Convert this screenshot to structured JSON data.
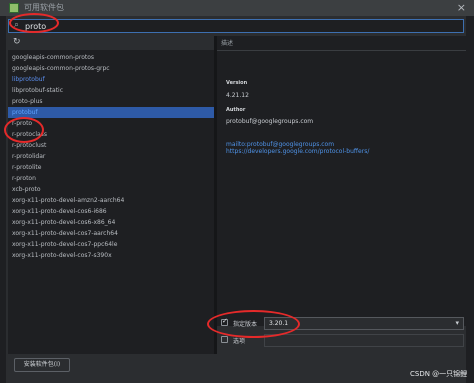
{
  "window": {
    "title": "可用软件包",
    "close_glyph": "×"
  },
  "search": {
    "icon": "search-icon",
    "value": "proto",
    "placeholder": ""
  },
  "toolbar": {
    "refresh_icon": "refresh-icon"
  },
  "packages": {
    "items": [
      {
        "label": "googleapis-common-protos",
        "state": "normal"
      },
      {
        "label": "googleapis-common-protos-grpc",
        "state": "normal"
      },
      {
        "label": "libprotobuf",
        "state": "highlight"
      },
      {
        "label": "libprotobuf-static",
        "state": "normal"
      },
      {
        "label": "proto-plus",
        "state": "normal"
      },
      {
        "label": "protobuf",
        "state": "selected"
      },
      {
        "label": "r-proto",
        "state": "normal"
      },
      {
        "label": "r-protoclass",
        "state": "normal"
      },
      {
        "label": "r-protoclust",
        "state": "normal"
      },
      {
        "label": "r-protolidar",
        "state": "normal"
      },
      {
        "label": "r-protolite",
        "state": "normal"
      },
      {
        "label": "r-proton",
        "state": "normal"
      },
      {
        "label": "xcb-proto",
        "state": "normal"
      },
      {
        "label": "xorg-x11-proto-devel-amzn2-aarch64",
        "state": "normal"
      },
      {
        "label": "xorg-x11-proto-devel-cos6-i686",
        "state": "normal"
      },
      {
        "label": "xorg-x11-proto-devel-cos6-x86_64",
        "state": "normal"
      },
      {
        "label": "xorg-x11-proto-devel-cos7-aarch64",
        "state": "normal"
      },
      {
        "label": "xorg-x11-proto-devel-cos7-ppc64le",
        "state": "normal"
      },
      {
        "label": "xorg-x11-proto-devel-cos7-s390x",
        "state": "normal"
      }
    ]
  },
  "description": {
    "heading": "描述",
    "version_label": "Version",
    "version_value": "4.21.12",
    "author_label": "Author",
    "author_value": "protobuf@googlegroups.com",
    "link_mail": "mailto:protobuf@googlegroups.com",
    "link_site": "https://developers.google.com/protocol-buffers/"
  },
  "options": {
    "specify_version_label": "指定版本",
    "specify_version_checked": true,
    "version_selected": "3.20.1",
    "options_label": "选项",
    "options_checked": false,
    "options_value": ""
  },
  "install_button": {
    "label": "安装软件包(I)"
  },
  "watermark": {
    "text": "CSDN @一只锦鲤"
  },
  "colors": {
    "accent": "#2e5aa7",
    "link": "#4f93e8",
    "annotation": "#e52a2a",
    "background": "#2b2d30"
  }
}
